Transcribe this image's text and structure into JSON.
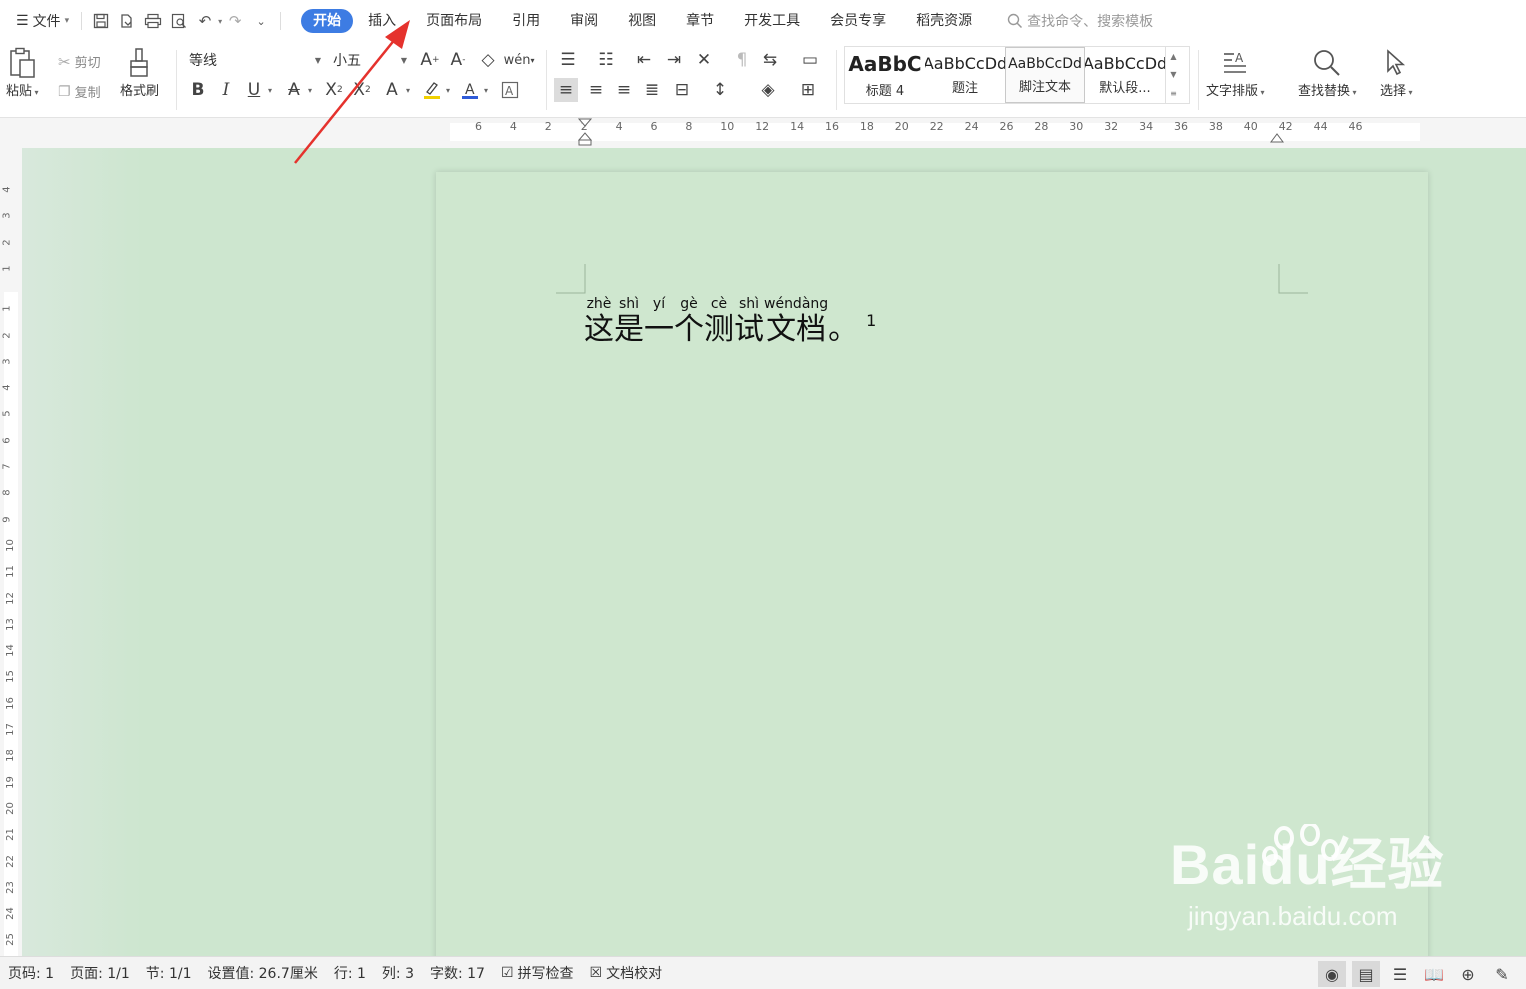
{
  "menubar": {
    "file_label": "文件",
    "tabs": [
      {
        "label": "开始",
        "active": true
      },
      {
        "label": "插入"
      },
      {
        "label": "页面布局"
      },
      {
        "label": "引用"
      },
      {
        "label": "审阅"
      },
      {
        "label": "视图"
      },
      {
        "label": "章节"
      },
      {
        "label": "开发工具"
      },
      {
        "label": "会员专享"
      },
      {
        "label": "稻壳资源"
      }
    ],
    "search_placeholder": "查找命令、搜索模板"
  },
  "ribbon": {
    "paste": "粘贴",
    "cut": "剪切",
    "copy": "复制",
    "format_painter": "格式刷",
    "font_name": "等线",
    "font_size": "小五",
    "pinyin_glyph": "wén",
    "styles": [
      {
        "sample": "AaBbC",
        "name": "标题 4",
        "bold": true
      },
      {
        "sample": "AaBbCcDd",
        "name": "题注"
      },
      {
        "sample": "AaBbCcDd",
        "name": "脚注文本",
        "selected": true
      },
      {
        "sample": "AaBbCcDd",
        "name": "默认段..."
      }
    ],
    "text_layout": "文字排版",
    "find_replace": "查找替换",
    "select": "选择"
  },
  "ruler": {
    "h_ticks": [
      "6",
      "4",
      "2",
      "2",
      "4",
      "6",
      "8",
      "10",
      "12",
      "14",
      "16",
      "18",
      "20",
      "22",
      "24",
      "26",
      "28",
      "30",
      "32",
      "34",
      "36",
      "38",
      "40",
      "42",
      "44",
      "46"
    ],
    "v_ticks": [
      "4",
      "3",
      "2",
      "1",
      "1",
      "2",
      "3",
      "4",
      "5",
      "6",
      "7",
      "8",
      "9",
      "10",
      "11",
      "12",
      "13",
      "14",
      "15",
      "16",
      "17",
      "18",
      "19",
      "20",
      "21",
      "22",
      "23",
      "24",
      "25"
    ]
  },
  "document": {
    "chars": [
      {
        "hz": "这",
        "py": "zhè"
      },
      {
        "hz": "是",
        "py": "shì"
      },
      {
        "hz": "一",
        "py": "yí"
      },
      {
        "hz": "个",
        "py": "gè"
      },
      {
        "hz": "测",
        "py": "cè"
      },
      {
        "hz": "试",
        "py": "shì"
      },
      {
        "hz": "文档",
        "py": "wéndàng"
      },
      {
        "hz": "。",
        "py": ""
      }
    ],
    "footnote_mark": "1"
  },
  "watermark": {
    "logo": "Baidu经验",
    "url": "jingyan.baidu.com"
  },
  "statusbar": {
    "page_code": "页码: 1",
    "page": "页面: 1/1",
    "section": "节: 1/1",
    "setting": "设置值: 26.7厘米",
    "row": "行: 1",
    "col": "列: 3",
    "word_count": "字数: 17",
    "spell_check": "拼写检查",
    "doc_proof": "文档校对"
  },
  "colors": {
    "accent": "#3d7ce3",
    "page_bg": "#cfe7cf",
    "arrow": "#e5322d"
  }
}
